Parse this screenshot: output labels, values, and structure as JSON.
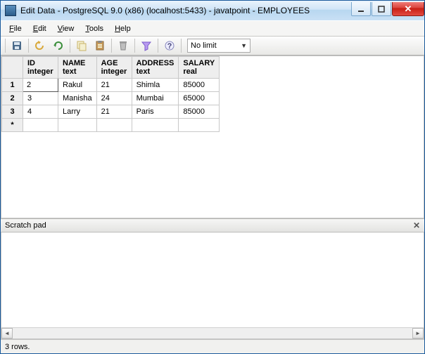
{
  "window": {
    "title": "Edit Data - PostgreSQL 9.0 (x86) (localhost:5433) - javatpoint - EMPLOYEES"
  },
  "menu": {
    "file": "File",
    "edit": "Edit",
    "view": "View",
    "tools": "Tools",
    "help": "Help"
  },
  "toolbar": {
    "limit_selected": "No limit"
  },
  "grid": {
    "columns": [
      {
        "name": "ID",
        "type": "integer"
      },
      {
        "name": "NAME",
        "type": "text"
      },
      {
        "name": "AGE",
        "type": "integer"
      },
      {
        "name": "ADDRESS",
        "type": "text"
      },
      {
        "name": "SALARY",
        "type": "real"
      }
    ],
    "rows": [
      {
        "n": "1",
        "ID": "2",
        "NAME": "Rakul",
        "AGE": "21",
        "ADDRESS": "Shimla",
        "SALARY": "85000"
      },
      {
        "n": "2",
        "ID": "3",
        "NAME": "Manisha",
        "AGE": "24",
        "ADDRESS": "Mumbai",
        "SALARY": "65000"
      },
      {
        "n": "3",
        "ID": "4",
        "NAME": "Larry",
        "AGE": "21",
        "ADDRESS": "Paris",
        "SALARY": "85000"
      }
    ]
  },
  "scratch": {
    "label": "Scratch pad"
  },
  "status": {
    "text": "3 rows."
  }
}
